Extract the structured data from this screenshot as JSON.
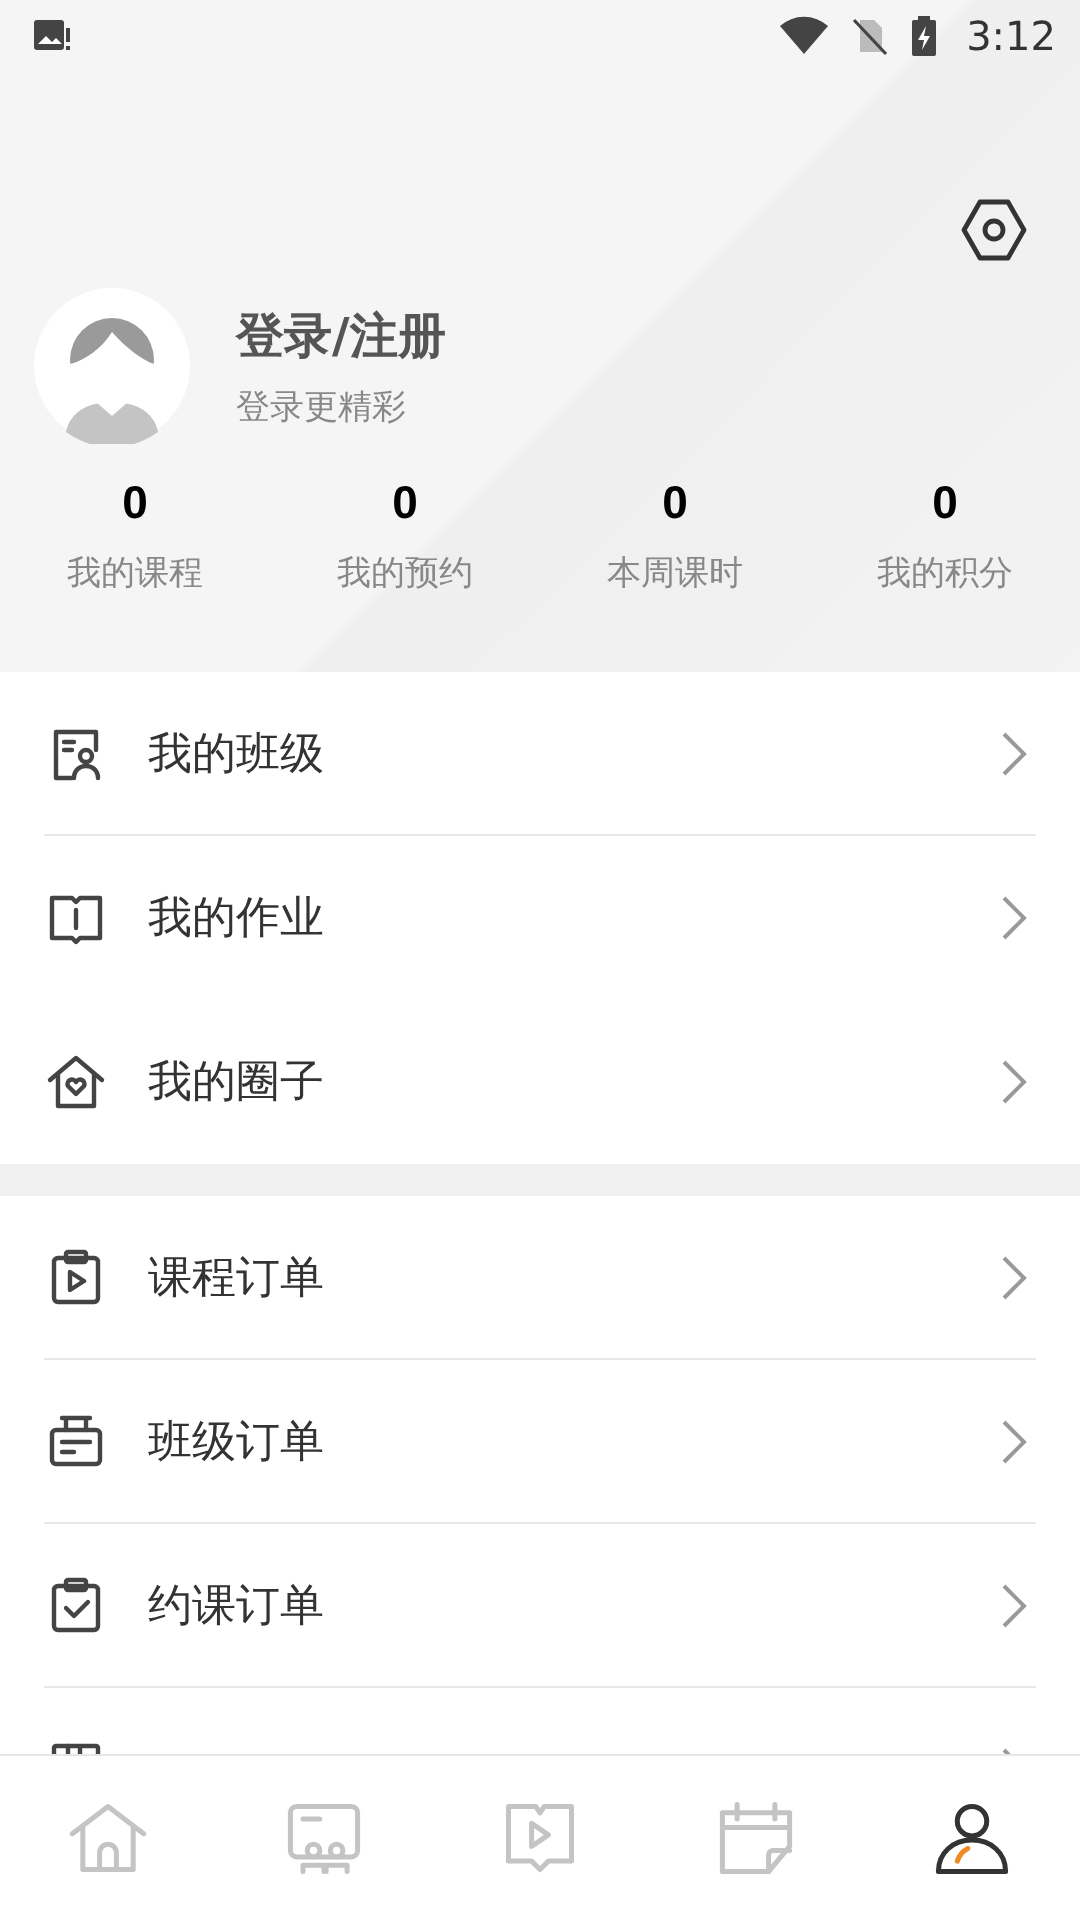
{
  "status_bar": {
    "time": "3:12"
  },
  "profile": {
    "title": "登录/注册",
    "subtitle": "登录更精彩"
  },
  "stats": [
    {
      "value": "0",
      "label": "我的课程"
    },
    {
      "value": "0",
      "label": "我的预约"
    },
    {
      "value": "0",
      "label": "本周课时"
    },
    {
      "value": "0",
      "label": "我的积分"
    }
  ],
  "menu_groups": [
    [
      {
        "kind": "class",
        "label": "我的班级",
        "divider": true
      },
      {
        "kind": "homework",
        "label": "我的作业",
        "divider": false
      },
      {
        "kind": "circle",
        "label": "我的圈子",
        "divider": false
      }
    ],
    [
      {
        "kind": "course_order",
        "label": "课程订单",
        "divider": true
      },
      {
        "kind": "class_order",
        "label": "班级订单",
        "divider": true
      },
      {
        "kind": "booking_order",
        "label": "约课订单",
        "divider": true
      },
      {
        "kind": "book_order"
      }
    ]
  ],
  "bottom_nav": [
    {
      "kind": "home",
      "selected": false
    },
    {
      "kind": "classes",
      "selected": false
    },
    {
      "kind": "video",
      "selected": false
    },
    {
      "kind": "calendar",
      "selected": false
    },
    {
      "kind": "profile",
      "selected": true
    }
  ]
}
